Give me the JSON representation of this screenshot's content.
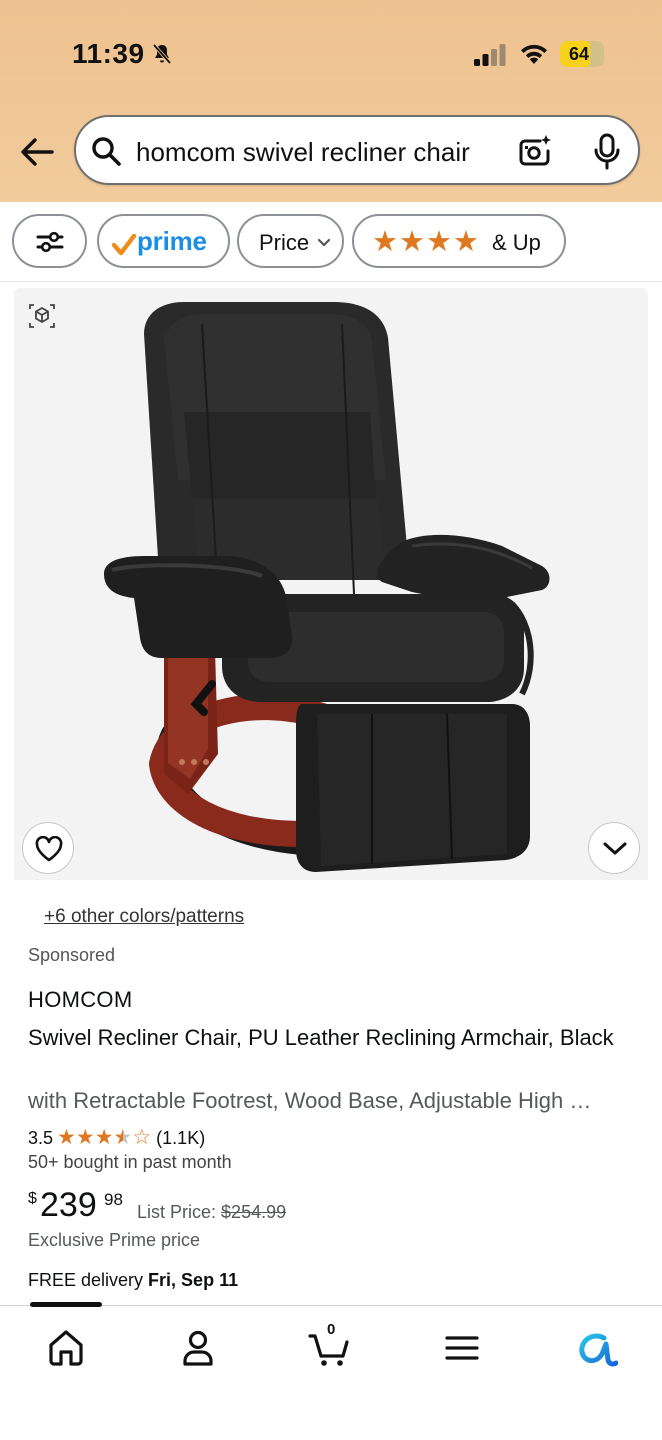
{
  "status_bar": {
    "time": "11:39",
    "battery": "64",
    "icons": [
      "bell-off-icon",
      "signal-icon",
      "wifi-icon",
      "battery-icon"
    ]
  },
  "search": {
    "query": "homcom swivel recliner chair",
    "icons": [
      "back-arrow-icon",
      "search-icon",
      "camera-icon",
      "microphone-icon"
    ]
  },
  "filters": {
    "prime_label": "prime",
    "price_label": "Price",
    "rating_label": "& Up",
    "rating_stars": 4
  },
  "product": {
    "colors_link": "+6 other colors/patterns",
    "sponsored": "Sponsored",
    "brand": "HOMCOM",
    "title": "Swivel Recliner Chair, PU Leather Reclining Armchair, Black",
    "subtitle": "with Retractable Footrest, Wood Base, Adjustable High …",
    "rating_value": "3.5",
    "rating_count": "(1.1K)",
    "bought": "50+ bought in past month",
    "price_symbol": "$",
    "price_whole": "239",
    "price_fraction": "98",
    "list_price_label": "List Price:",
    "list_price": "$254.99",
    "exclusive": "Exclusive Prime price",
    "delivery_prefix": "FREE delivery",
    "delivery_date": "Fri, Sep 11"
  },
  "bottom_nav": {
    "cart_count": "0",
    "items": [
      "home-icon",
      "account-icon",
      "cart-icon",
      "menu-icon",
      "rufus-icon"
    ]
  },
  "colors": {
    "header_bg": "#f0c796",
    "prime_blue": "#1a8ee6",
    "star_orange": "#de7921",
    "battery_yellow": "#f7d21a"
  }
}
